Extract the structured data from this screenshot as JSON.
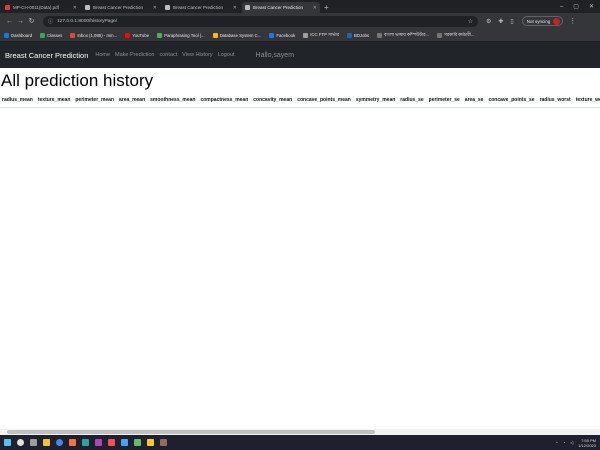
{
  "browser": {
    "tabs": [
      {
        "title": "MP-CH-0011(Data).pdf",
        "active": false,
        "color": "#e53935"
      },
      {
        "title": "Breast Cancer Prediction",
        "active": false,
        "color": "#bdbdbd"
      },
      {
        "title": "Breast Cancer Prediction",
        "active": false,
        "color": "#bdbdbd"
      },
      {
        "title": "Breast Cancer Prediction",
        "active": true,
        "color": "#bdbdbd"
      }
    ],
    "url": "127.0.0.1:8000/historyPage/",
    "profile_label": "Not syncing",
    "bookmarks": [
      {
        "label": "Dashboard",
        "color": "#1a73e8"
      },
      {
        "label": "Classes",
        "color": "#34a853"
      },
      {
        "label": "Inbox (1,085) - mm...",
        "color": "#ea4335"
      },
      {
        "label": "YouTube",
        "color": "#ff0000"
      },
      {
        "label": "Paraphrasing Tool |...",
        "color": "#4caf50"
      },
      {
        "label": "Database System C...",
        "color": "#fbbc04"
      },
      {
        "label": "Facebook",
        "color": "#1877f2"
      },
      {
        "label": "ICC FTP সার্ভার",
        "color": "#9e9e9e"
      },
      {
        "label": "BDJobs",
        "color": "#1565c0"
      },
      {
        "label": "বাংলা ভাষায় কম্পিউটার...",
        "color": "#757575"
      },
      {
        "label": "সরকারি কর্মচারী...",
        "color": "#757575"
      }
    ]
  },
  "site": {
    "brand": "Breast Cancer Prediction",
    "nav": [
      "Home",
      "Make Prediction",
      "contact",
      "View History",
      "Logout"
    ],
    "greeting": "Hallo,sayem"
  },
  "page": {
    "title": "All prediction history",
    "columns": [
      "radius_mean",
      "texture_mean",
      "perimeter_mean",
      "area_mean",
      "smoothness_mean",
      "compactness_mean",
      "concavity_mean",
      "concave_points_mean",
      "symmetry_mean",
      "radius_se",
      "perimeter_se",
      "area_se",
      "concave_points_se",
      "radius_worst",
      "texture_worst"
    ]
  },
  "taskbar": {
    "time": "7:55 PM",
    "date": "1/12/2023"
  }
}
